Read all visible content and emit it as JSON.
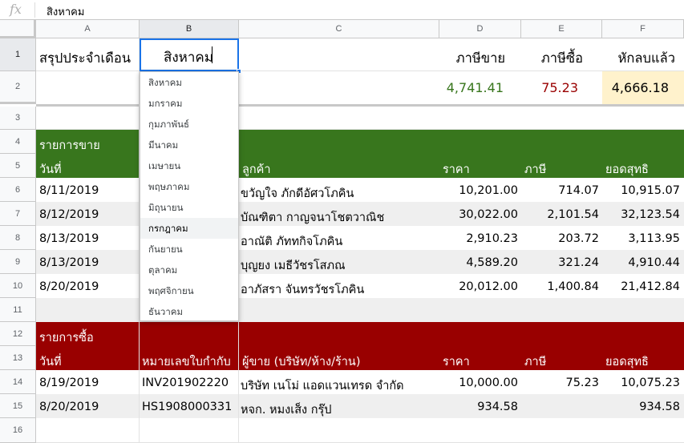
{
  "formula_bar": {
    "fx_icon": "fx",
    "value": "สิงหาคม"
  },
  "columns": [
    "A",
    "B",
    "C",
    "D",
    "E",
    "F"
  ],
  "rows": [
    "1",
    "2",
    "3",
    "4",
    "5",
    "6",
    "7",
    "8",
    "9",
    "10",
    "11",
    "12",
    "13",
    "14",
    "15",
    "16"
  ],
  "summary": {
    "title": "สรุปประจำเดือน",
    "month": "สิงหาคม",
    "labels": {
      "sales_tax": "ภาษีขาย",
      "purchase_tax": "ภาษีซื้อ",
      "net": "หักลบแล้ว"
    },
    "values": {
      "sales_tax": "4,741.41",
      "purchase_tax": "75.23",
      "net": "4,666.18"
    }
  },
  "sales": {
    "section_title": "รายการขาย",
    "headers": {
      "date": "วันที่",
      "customer": "ลูกค้า",
      "price": "ราคา",
      "tax": "ภาษี",
      "total": "ยอดสุทธิ"
    },
    "rows": [
      {
        "date": "8/11/2019",
        "customer": "ขวัญใจ ภักดีอัศวโภคิน",
        "price": "10,201.00",
        "tax": "714.07",
        "total": "10,915.07"
      },
      {
        "date": "8/12/2019",
        "customer": "บัณฑิตา กาญจนาโชตวาณิช",
        "price": "30,022.00",
        "tax": "2,101.54",
        "total": "32,123.54"
      },
      {
        "date": "8/13/2019",
        "customer": "อาณัติ ภัททกิจโภคิน",
        "price": "2,910.23",
        "tax": "203.72",
        "total": "3,113.95"
      },
      {
        "date": "8/13/2019",
        "customer": "บุญยง เมธีวัชรโสภณ",
        "price": "4,589.20",
        "tax": "321.24",
        "total": "4,910.44"
      },
      {
        "date": "8/20/2019",
        "customer": "อาภัสรา จันทรวัชรโภคิน",
        "price": "20,012.00",
        "tax": "1,400.84",
        "total": "21,412.84"
      }
    ]
  },
  "purchases": {
    "section_title": "รายการซื้อ",
    "headers": {
      "date": "วันที่",
      "invoice": "หมายเลขใบกำกับ",
      "vendor": "ผู้ขาย (บริษัท/ห้าง/ร้าน)",
      "price": "ราคา",
      "tax": "ภาษี",
      "total": "ยอดสุทธิ"
    },
    "rows": [
      {
        "date": "8/19/2019",
        "invoice": "INV201902220",
        "vendor": "บริษัท เนโม่ แอดแวนเทรด จำกัด",
        "price": "10,000.00",
        "tax": "75.23",
        "total": "10,075.23"
      },
      {
        "date": "8/20/2019",
        "invoice": "HS1908000331",
        "vendor": "หจก. หมงเส็ง กรุ๊ป",
        "price": "934.58",
        "tax": "",
        "total": "934.58"
      }
    ]
  },
  "dropdown": {
    "highlighted": "กรกฎาคม",
    "options": [
      "สิงหาคม",
      "มกราคม",
      "กุมภาพันธ์",
      "มีนาคม",
      "เมษายน",
      "พฤษภาคม",
      "มิถุนายน",
      "กรกฎาคม",
      "กันยายน",
      "ตุลาคม",
      "พฤศจิกายน",
      "ธันวาคม"
    ]
  },
  "colors": {
    "sales_header": "#38761d",
    "purchase_header": "#990000",
    "sales_tax_value": "#38761d",
    "purchase_tax_value": "#990000",
    "net_bg": "#fff2cc",
    "selection": "#1a73e8"
  }
}
